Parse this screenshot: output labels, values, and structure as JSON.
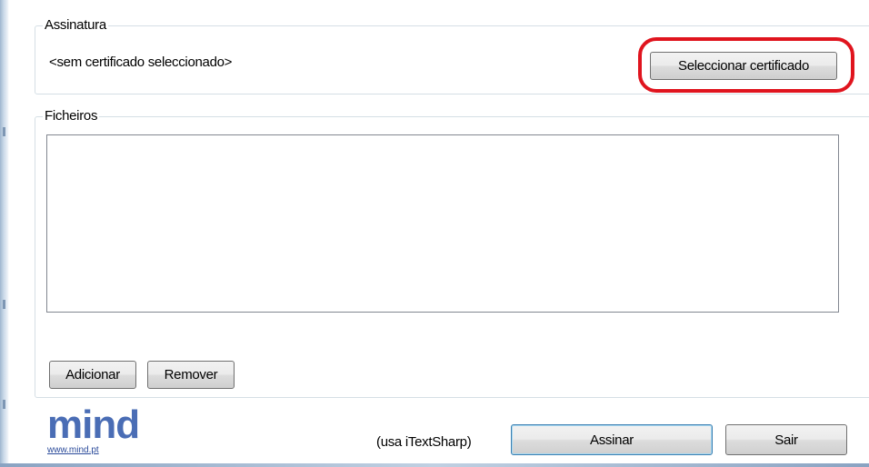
{
  "signature": {
    "group_label": "Assinatura",
    "status_text": "<sem certificado seleccionado>",
    "select_button": "Seleccionar certificado"
  },
  "files": {
    "group_label": "Ficheiros",
    "add_button": "Adicionar",
    "remove_button": "Remover",
    "items": []
  },
  "footer": {
    "logo_text": "mind",
    "logo_url": "www.mind.pt",
    "library_note": "(usa iTextSharp)",
    "sign_button": "Assinar",
    "exit_button": "Sair"
  },
  "colors": {
    "highlight": "#e0141e",
    "logo": "#4a6db5",
    "default_button_border": "#3c7fb1"
  }
}
